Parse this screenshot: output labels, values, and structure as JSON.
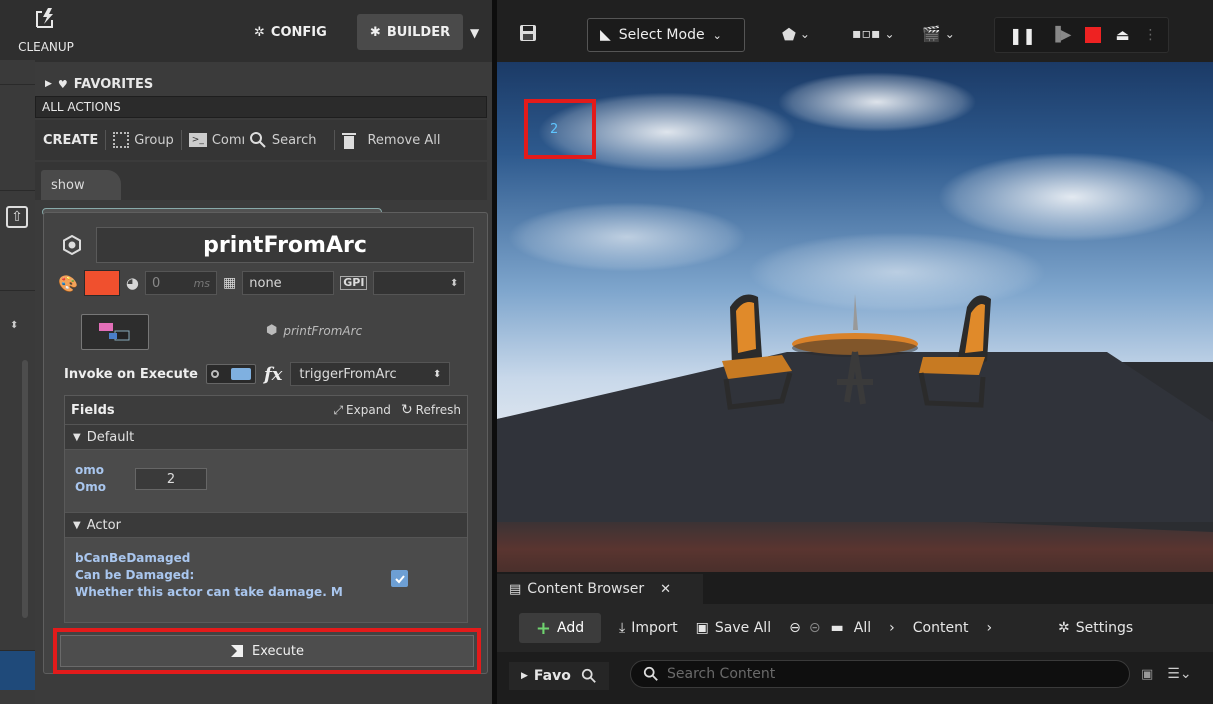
{
  "left_panel": {
    "cleanup_label": "CLEANUP",
    "config_label": "CONFIG",
    "builder_label": "BUILDER",
    "dropdown_glyph": "▼",
    "favorites_label": "FAVORITES",
    "all_actions_label": "ALL ACTIONS",
    "toolbar": {
      "create_label": "CREATE",
      "group_label": "Group",
      "command_label": "Comı",
      "search_label": "Search",
      "remove_all_label": "Remove All"
    },
    "tab_show_label": "show",
    "card": {
      "title": "printFromArc",
      "delay_value": "0",
      "delay_unit": "ms",
      "layer_value": "none",
      "gpi_tag": "GPI",
      "gpi_value": "",
      "class_name": "printFromArc",
      "invoke_label": "Invoke on Execute",
      "fx_function": "triggerFromArc",
      "fields": {
        "title": "Fields",
        "expand_label": "Expand",
        "refresh_label": "Refresh",
        "sections": [
          {
            "name": "Default",
            "field_name": "omo",
            "field_display": "Omo",
            "field_value": "2"
          },
          {
            "name": "Actor",
            "field_name": "bCanBeDamaged",
            "field_display": "Can be Damaged:",
            "field_desc": "Whether this actor can take damage. M",
            "checked": true
          }
        ]
      },
      "execute_label": "Execute"
    }
  },
  "editor": {
    "select_mode_label": "Select Mode",
    "viewport_number": "2",
    "content_browser": {
      "tab_label": "Content Browser",
      "add_label": "Add",
      "import_label": "Import",
      "save_all_label": "Save All",
      "breadcrumb": [
        "All",
        "Content"
      ],
      "settings_label": "Settings",
      "favo_label": "Favo",
      "search_placeholder": "Search Content"
    }
  },
  "colors": {
    "highlight": "#e31b1b",
    "action_color": "#f0502e",
    "field_label": "#a9c6ee"
  }
}
